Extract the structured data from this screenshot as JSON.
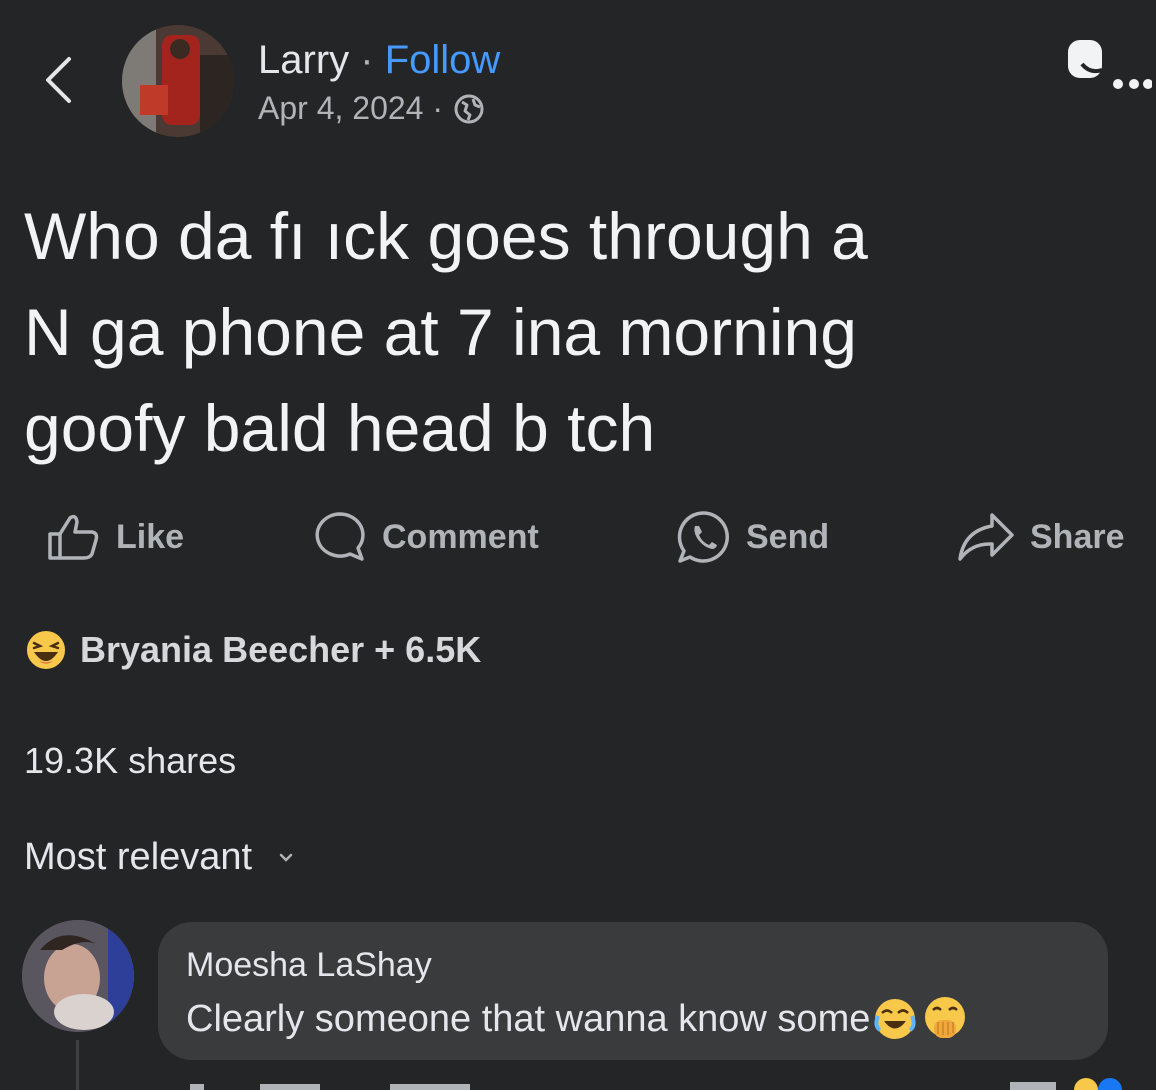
{
  "header": {
    "name": "Larry",
    "separator": "·",
    "follow_label": "Follow",
    "date": "Apr 4, 2024 ·",
    "icons": {
      "back": "chevron-left-icon",
      "privacy": "globe-icon",
      "more": "more-icon"
    }
  },
  "post": {
    "lines": [
      "Who da fı ıck goes through a",
      "N ga phone at 7 ina morning",
      "goofy bald head b tch"
    ]
  },
  "actions": {
    "like": "Like",
    "comment": "Comment",
    "send": "Send",
    "share": "Share"
  },
  "reactions": {
    "summary": "Bryania Beecher + 6.5K",
    "icon": "laughing-emoji-icon"
  },
  "shares_count": "19.3K shares",
  "comments": {
    "sort_label": "Most relevant",
    "items": [
      {
        "author": "Moesha LaShay",
        "text": "Clearly someone that wanna know some"
      }
    ]
  },
  "colors": {
    "background": "#242526",
    "follow": "#4599ff",
    "bubble": "#3a3b3c",
    "muted": "#b0b3b8"
  }
}
